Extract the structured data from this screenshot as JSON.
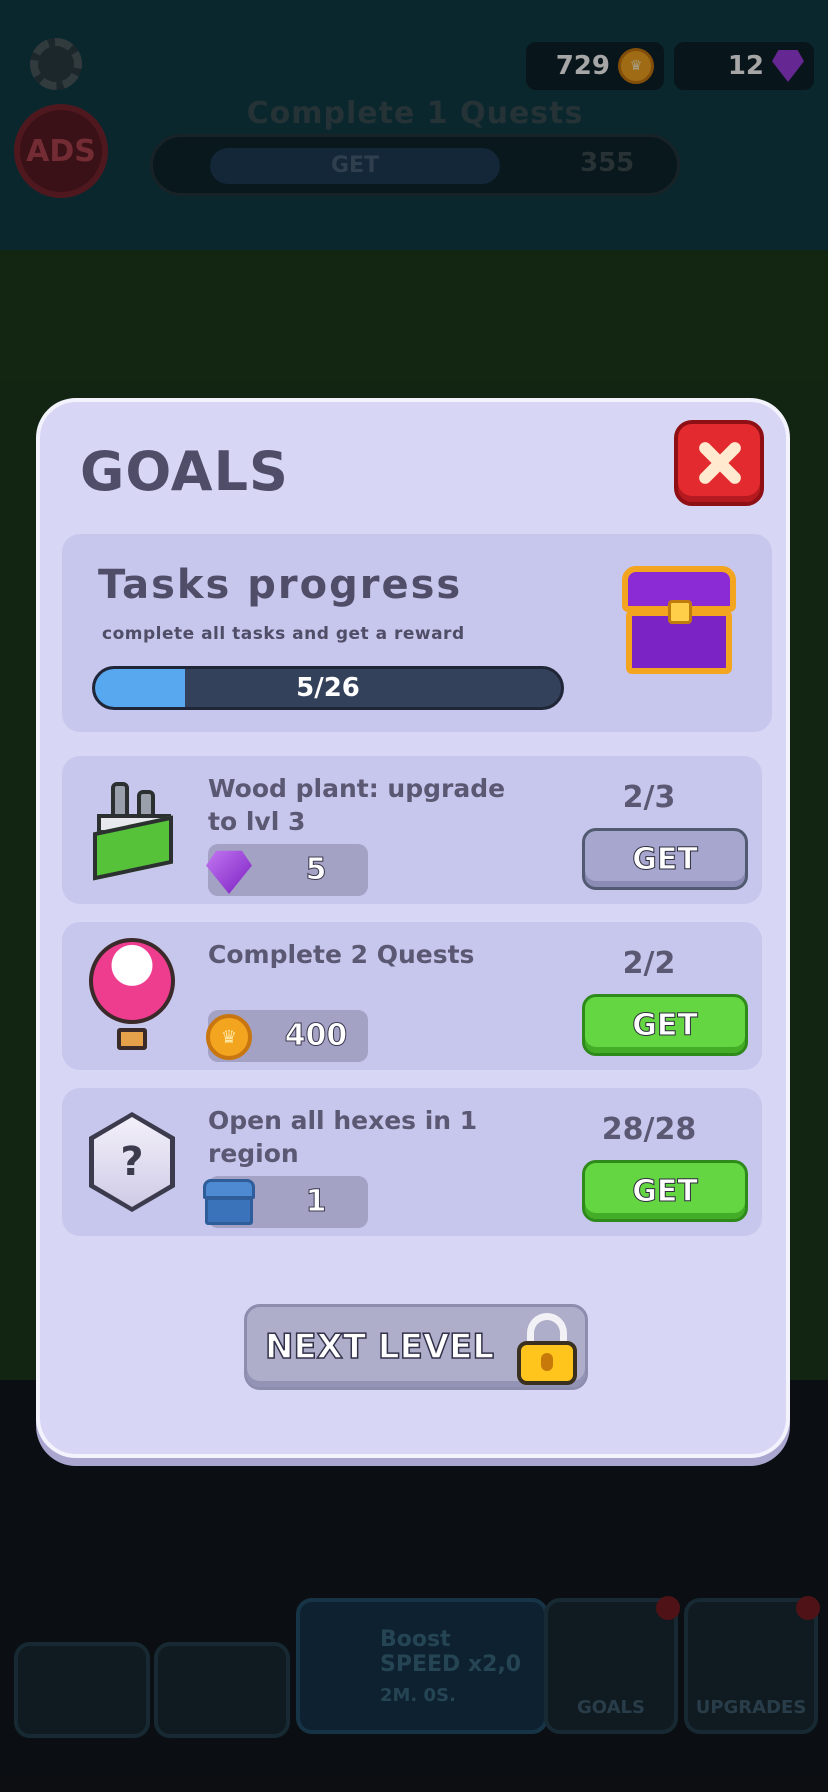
{
  "hud": {
    "coins": "729",
    "gems": "12",
    "ads_label": "ADS",
    "quest_title": "Complete 1 Quests",
    "quest_get": "GET",
    "quest_reward": "355"
  },
  "bottom_tabs": {
    "boost_title": "Boost",
    "boost_speed": "SPEED x2,0",
    "boost_time": "2M. 0S.",
    "goals": "GOALS",
    "upgrades": "UPGRADES"
  },
  "modal": {
    "title": "GOALS",
    "progress": {
      "title": "Tasks progress",
      "subtitle": "complete all tasks and get a reward",
      "text": "5/26",
      "current": 5,
      "total": 26
    },
    "tasks": [
      {
        "name": "Wood plant: upgrade to lvl 3",
        "reward": "5",
        "reward_icon": "gem-icon",
        "count": "2/3",
        "button": "GET",
        "state": "disabled"
      },
      {
        "name": "Complete 2 Quests",
        "reward": "400",
        "reward_icon": "coin-icon",
        "count": "2/2",
        "button": "GET",
        "state": "active"
      },
      {
        "name": "Open all hexes in 1 region",
        "reward": "1",
        "reward_icon": "chest-icon",
        "count": "28/28",
        "button": "GET",
        "state": "active"
      }
    ],
    "next_level": "NEXT LEVEL"
  },
  "colors": {
    "modal_bg": "#d7d7f5",
    "get_active": "#64d642",
    "get_disabled": "#a6a6cf",
    "progress_fill": "#58a8ef",
    "close_red": "#e32a2f"
  }
}
